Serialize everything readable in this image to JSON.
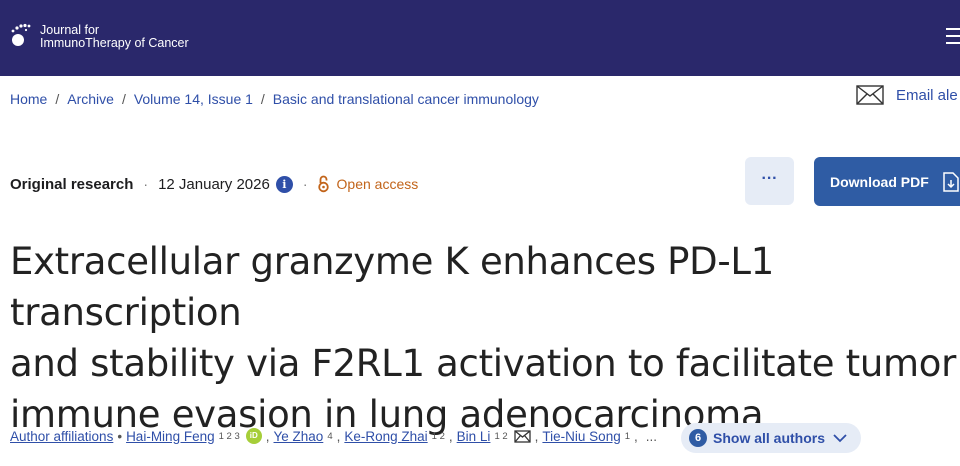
{
  "header": {
    "journal_line1": "Journal for",
    "journal_line2": "ImmunoTherapy of Cancer",
    "menu_icon": "hamburger-menu-icon"
  },
  "breadcrumb": [
    {
      "label": "Home"
    },
    {
      "label": "Archive"
    },
    {
      "label": "Volume 14, Issue 1"
    },
    {
      "label": "Basic and translational cancer immunology"
    }
  ],
  "breadcrumb_separator": "/",
  "email_alerts": {
    "label": "Email ale",
    "icon": "envelope-icon"
  },
  "meta": {
    "article_type": "Original research",
    "separator": "·",
    "date": "12 January 2026",
    "info_icon": "i",
    "open_access": "Open access"
  },
  "actions": {
    "more_label": "···",
    "download_pdf": "Download PDF"
  },
  "title_lines": [
    "Extracellular granzyme K enhances PD-L1 transcription",
    "and stability via F2RL1 activation to facilitate tumor",
    "immune evasion in lung adenocarcinoma"
  ],
  "authors": {
    "affiliations_label": "Author affiliations",
    "bullet": "•",
    "list": [
      {
        "name": "Hai-Ming Feng",
        "sup": "1 2 3"
      },
      {
        "name": "Ye Zhao",
        "sup": "4"
      },
      {
        "name": "Ke-Rong Zhai",
        "sup": "1 2"
      },
      {
        "name": "Bin Li",
        "sup": "1 2"
      },
      {
        "name": "Tie-Niu Song",
        "sup": "1"
      }
    ],
    "orcid_label": "iD",
    "comma": ",",
    "ellipsis": "...",
    "show_all_count": "6",
    "show_all_label": "Show all authors"
  },
  "colors": {
    "header_bg": "#2a286b",
    "link": "#2f4fa8",
    "primary_button": "#2f5ca4",
    "open_access": "#c2641a",
    "orcid": "#a6ce39"
  }
}
